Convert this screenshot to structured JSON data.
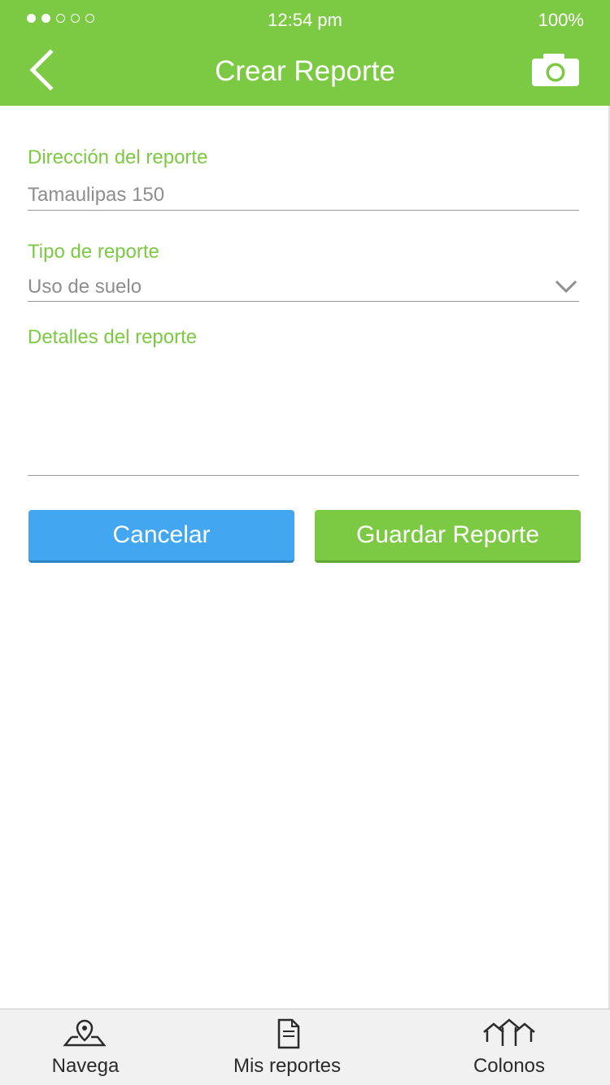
{
  "status_bar": {
    "signal_dots": [
      true,
      true,
      false,
      false,
      false
    ],
    "time": "12:54 pm",
    "battery": "100%"
  },
  "header": {
    "title": "Crear Reporte",
    "back_icon": "chevron-left-icon",
    "camera_icon": "camera-icon",
    "background_color": "#7cc943"
  },
  "form": {
    "address": {
      "label": "Dirección del reporte",
      "value": "Tamaulipas 150"
    },
    "report_type": {
      "label": "Tipo de reporte",
      "value": "Uso de suelo"
    },
    "details": {
      "label": "Detalles del reporte",
      "value": ""
    }
  },
  "actions": {
    "cancel_label": "Cancelar",
    "save_label": "Guardar Reporte",
    "cancel_color": "#42a7f0",
    "save_color": "#7cc943"
  },
  "tabbar": {
    "items": [
      {
        "label": "Navega",
        "icon": "map-pin-icon"
      },
      {
        "label": "Mis reportes",
        "icon": "document-icon"
      },
      {
        "label": "Colonos",
        "icon": "houses-icon"
      }
    ]
  }
}
